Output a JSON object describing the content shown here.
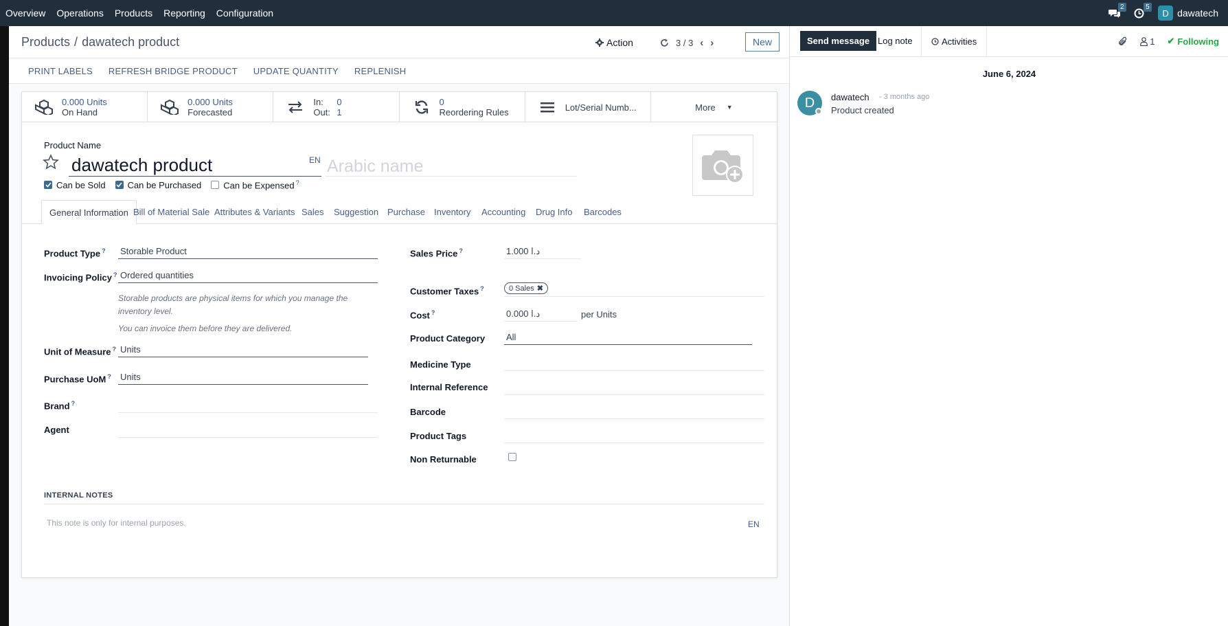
{
  "navbar": {
    "menu": [
      "Overview",
      "Operations",
      "Products",
      "Reporting",
      "Configuration"
    ],
    "messages_count": "2",
    "activities_count": "5",
    "user_initial": "D",
    "user_name": "dawatech"
  },
  "control_panel": {
    "breadcrumb_parent": "Products",
    "breadcrumb_separator": "/",
    "breadcrumb_current": "dawatech product",
    "action_label": "Action",
    "pager": "3 / 3",
    "new_label": "New"
  },
  "header_buttons": [
    "PRINT LABELS",
    "REFRESH BRIDGE PRODUCT",
    "UPDATE QUANTITY",
    "REPLENISH"
  ],
  "smart_buttons": {
    "on_hand_value": "0.000 Units",
    "on_hand_label": "On Hand",
    "forecasted_value": "0.000 Units",
    "forecasted_label": "Forecasted",
    "in_label": "In:",
    "in_value": "0",
    "out_label": "Out:",
    "out_value": "1",
    "reordering_value": "0",
    "reordering_label": "Reordering Rules",
    "lot_label": "Lot/Serial Numb...",
    "more_label": "More"
  },
  "product": {
    "name_label": "Product Name",
    "name": "dawatech product",
    "lang": "EN",
    "arabic_placeholder": "Arabic name",
    "can_be_sold": "Can be Sold",
    "can_be_purchased": "Can be Purchased",
    "can_be_expensed": "Can be Expensed",
    "help_mark": "?"
  },
  "tabs": [
    "General Information",
    "Bill of Material Sale",
    "Attributes & Variants",
    "Sales",
    "Suggestion",
    "Purchase",
    "Inventory",
    "Accounting",
    "Drug Info",
    "Barcodes"
  ],
  "left_fields": {
    "product_type_label": "Product Type",
    "product_type": "Storable Product",
    "invoicing_label": "Invoicing Policy",
    "invoicing": "Ordered quantities",
    "help_1": "Storable products are physical items for which you manage the",
    "help_2": "inventory level.",
    "help_3": "You can invoice them before they are delivered.",
    "uom_label": "Unit of Measure",
    "uom": "Units",
    "purchase_uom_label": "Purchase UoM",
    "purchase_uom": "Units",
    "brand_label": "Brand",
    "agent_label": "Agent"
  },
  "right_fields": {
    "sales_price_label": "Sales Price",
    "sales_price": "د.ا 1.000",
    "customer_taxes_label": "Customer Taxes",
    "customer_tax_tag": "0 Sales",
    "cost_label": "Cost",
    "cost": "د.ا 0.000",
    "per_units": "per Units",
    "category_label": "Product Category",
    "category": "All",
    "medicine_type_label": "Medicine Type",
    "internal_ref_label": "Internal Reference",
    "barcode_label": "Barcode",
    "tags_label": "Product Tags",
    "non_returnable_label": "Non Returnable"
  },
  "notes": {
    "title": "INTERNAL NOTES",
    "placeholder": "This note is only for internal purposes.",
    "lang": "EN"
  },
  "chatter": {
    "send_message": "Send message",
    "log_note": "Log note",
    "activities": "Activities",
    "followers_count": "1",
    "following": "Following",
    "date": "June 6, 2024",
    "author_initial": "D",
    "author": "dawatech",
    "time": "- 3 months ago",
    "body": "Product created"
  }
}
